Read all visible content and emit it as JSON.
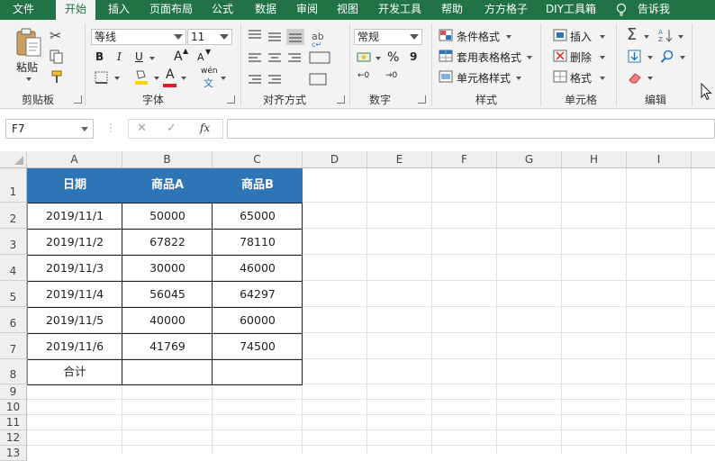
{
  "menu": {
    "tabs": [
      "文件",
      "开始",
      "插入",
      "页面布局",
      "公式",
      "数据",
      "审阅",
      "视图",
      "开发工具",
      "帮助",
      "方方格子",
      "DIY工具箱"
    ],
    "tell_me": "告诉我",
    "active_tab": "开始"
  },
  "ribbon": {
    "clipboard": {
      "paste_label": "粘贴",
      "group_label": "剪贴板"
    },
    "font": {
      "font_name": "等线",
      "font_size": "11",
      "group_label": "字体",
      "bold": "B",
      "italic": "I",
      "underline": "U",
      "grow": "A",
      "shrink": "A",
      "phonetic": "wén",
      "font_color_glyph": "A"
    },
    "alignment": {
      "group_label": "对齐方式"
    },
    "number": {
      "format": "常规",
      "percent": "%",
      "comma": "9",
      "group_label": "数字"
    },
    "styles": {
      "conditional": "条件格式",
      "table": "套用表格格式",
      "cell_styles": "单元格样式",
      "group_label": "样式"
    },
    "cells": {
      "insert": "插入",
      "delete": "删除",
      "format": "格式",
      "group_label": "单元格"
    },
    "editing": {
      "group_label": "编辑"
    }
  },
  "formula_bar": {
    "name_box": "F7",
    "cancel": "✕",
    "enter": "✓",
    "fx": "fx",
    "formula": ""
  },
  "sheet": {
    "columns": [
      "A",
      "B",
      "C",
      "D",
      "E",
      "F",
      "G",
      "H",
      "I"
    ],
    "rows": [
      "1",
      "2",
      "3",
      "4",
      "5",
      "6",
      "7",
      "8",
      "9",
      "10",
      "11",
      "12",
      "13"
    ],
    "headers": [
      "日期",
      "商品A",
      "商品B"
    ],
    "data": [
      [
        "2019/11/1",
        "50000",
        "65000"
      ],
      [
        "2019/11/2",
        "67822",
        "78110"
      ],
      [
        "2019/11/3",
        "30000",
        "46000"
      ],
      [
        "2019/11/4",
        "56045",
        "64297"
      ],
      [
        "2019/11/5",
        "40000",
        "60000"
      ],
      [
        "2019/11/6",
        "41769",
        "74500"
      ]
    ],
    "total_label": "合计",
    "total_b": "",
    "total_c": ""
  },
  "colors": {
    "excel_green": "#217346",
    "header_blue": "#2e75b6",
    "font_red": "#e02020",
    "fill_yellow": "#ffd400"
  }
}
